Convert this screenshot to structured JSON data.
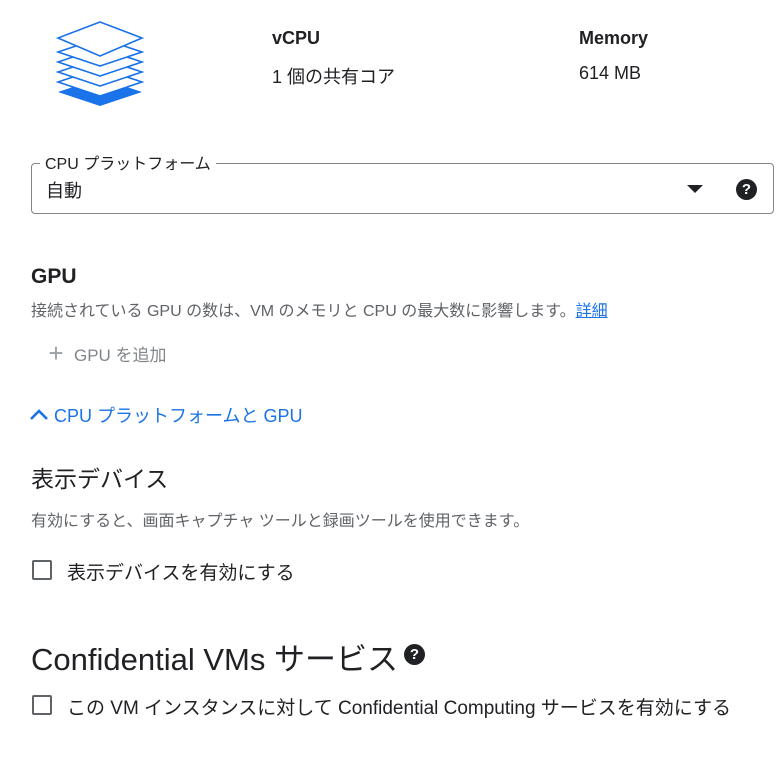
{
  "machine": {
    "icon": "layers-stack-icon",
    "vcpu_label": "vCPU",
    "vcpu_value": "1 個の共有コア",
    "memory_label": "Memory",
    "memory_value": "614 MB"
  },
  "cpu_platform": {
    "label": "CPU プラットフォーム",
    "value": "自動",
    "help": "?"
  },
  "gpu": {
    "heading": "GPU",
    "description": "接続されている GPU の数は、VM のメモリと CPU の最大数に影響します。",
    "link": "詳細",
    "add_label": "GPU を追加",
    "add_icon": "+"
  },
  "collapse": {
    "label": "CPU プラットフォームと GPU"
  },
  "display_device": {
    "heading": "表示デバイス",
    "description": "有効にすると、画面キャプチャ ツールと録画ツールを使用できます。",
    "checkbox_label": "表示デバイスを有効にする",
    "checked": false
  },
  "confidential": {
    "heading": "Confidential VMs サービス",
    "help": "?",
    "checkbox_label": "この VM インスタンスに対して Confidential Computing サービスを有効にする",
    "checked": false
  },
  "colors": {
    "accent": "#1a73e8",
    "text": "#202124",
    "secondary_text": "#5f6368"
  }
}
